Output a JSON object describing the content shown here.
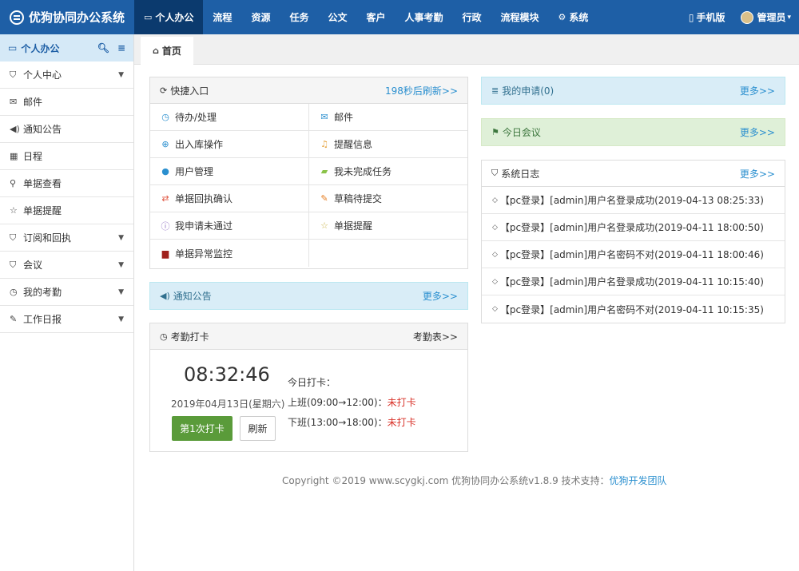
{
  "brand": {
    "title": "优狗协同办公系统"
  },
  "nav": [
    {
      "label": "个人办公",
      "icon": "monitor-icon",
      "active": true
    },
    {
      "label": "流程"
    },
    {
      "label": "资源"
    },
    {
      "label": "任务"
    },
    {
      "label": "公文"
    },
    {
      "label": "客户"
    },
    {
      "label": "人事考勤"
    },
    {
      "label": "行政"
    },
    {
      "label": "流程模块"
    },
    {
      "label": "系统",
      "icon": "gear-icon"
    }
  ],
  "topright": {
    "mobile": "手机版",
    "user": "管理员"
  },
  "sidebar": {
    "head": "个人办公",
    "items": [
      {
        "label": "个人中心",
        "icon": "bookmark-icon",
        "caret": true
      },
      {
        "label": "邮件",
        "icon": "envelope-icon",
        "caret": false
      },
      {
        "label": "通知公告",
        "icon": "speaker-icon",
        "caret": false
      },
      {
        "label": "日程",
        "icon": "calendar-icon",
        "caret": false
      },
      {
        "label": "单据查看",
        "icon": "search-icon",
        "caret": false
      },
      {
        "label": "单据提醒",
        "icon": "star-icon",
        "caret": false
      },
      {
        "label": "订阅和回执",
        "icon": "bookmark-icon",
        "caret": true
      },
      {
        "label": "会议",
        "icon": "bookmark-icon",
        "caret": true
      },
      {
        "label": "我的考勤",
        "icon": "clock-icon",
        "caret": true
      },
      {
        "label": "工作日报",
        "icon": "edit-icon",
        "caret": true
      }
    ]
  },
  "tabs": {
    "home": "首页"
  },
  "quick": {
    "title": "快捷入口",
    "refresh": "198秒后刷新>>",
    "items": [
      {
        "label": "待办/处理",
        "icon": "clock-icon",
        "color": "#2a8fcf"
      },
      {
        "label": "邮件",
        "icon": "envelope-icon",
        "color": "#2a8fcf"
      },
      {
        "label": "出入库操作",
        "icon": "plus-circle-icon",
        "color": "#2a8fcf"
      },
      {
        "label": "提醒信息",
        "icon": "bell-icon",
        "color": "#e6a23c"
      },
      {
        "label": "用户管理",
        "icon": "user-icon",
        "color": "#2a8fcf"
      },
      {
        "label": "我未完成任务",
        "icon": "book-icon",
        "color": "#8bc34a"
      },
      {
        "label": "单据回执确认",
        "icon": "exchange-icon",
        "color": "#e0533e"
      },
      {
        "label": "草稿待提交",
        "icon": "edit-icon",
        "color": "#e67e22"
      },
      {
        "label": "我申请未通过",
        "icon": "info-icon",
        "color": "#8e6cc2"
      },
      {
        "label": "单据提醒",
        "icon": "star-icon",
        "color": "#c9b44a"
      },
      {
        "label": "单据异常监控",
        "icon": "briefcase-icon",
        "color": "#a0201c"
      },
      {
        "label": "",
        "icon": "",
        "color": "#ffffff"
      }
    ]
  },
  "notice": {
    "title": "通知公告",
    "more": "更多>>"
  },
  "attendance": {
    "title": "考勤打卡",
    "link": "考勤表>>",
    "time": "08:32:46",
    "date": "2019年04月13日(星期六)",
    "punch_button": "第1次打卡",
    "refresh_button": "刷新",
    "today_label": "今日打卡：",
    "shift1": "上班(09:00→12:00)：",
    "shift1_status": "未打卡",
    "shift2": "下班(13:00→18:00)：",
    "shift2_status": "未打卡"
  },
  "my_apply": {
    "title": "我的申请(0)",
    "more": "更多>>"
  },
  "meeting": {
    "title": "今日会议",
    "more": "更多>>"
  },
  "syslog": {
    "title": "系统日志",
    "more": "更多>>",
    "items": [
      "【pc登录】[admin]用户名登录成功(2019-04-13 08:25:33)",
      "【pc登录】[admin]用户名登录成功(2019-04-11 18:00:50)",
      "【pc登录】[admin]用户名密码不对(2019-04-11 18:00:46)",
      "【pc登录】[admin]用户名登录成功(2019-04-11 10:15:40)",
      "【pc登录】[admin]用户名密码不对(2019-04-11 10:15:35)"
    ]
  },
  "footer": {
    "copyright": "Copyright ©2019  www.scygkj.com  优狗协同办公系统v1.8.9  技术支持：",
    "support": "优狗开发团队"
  }
}
